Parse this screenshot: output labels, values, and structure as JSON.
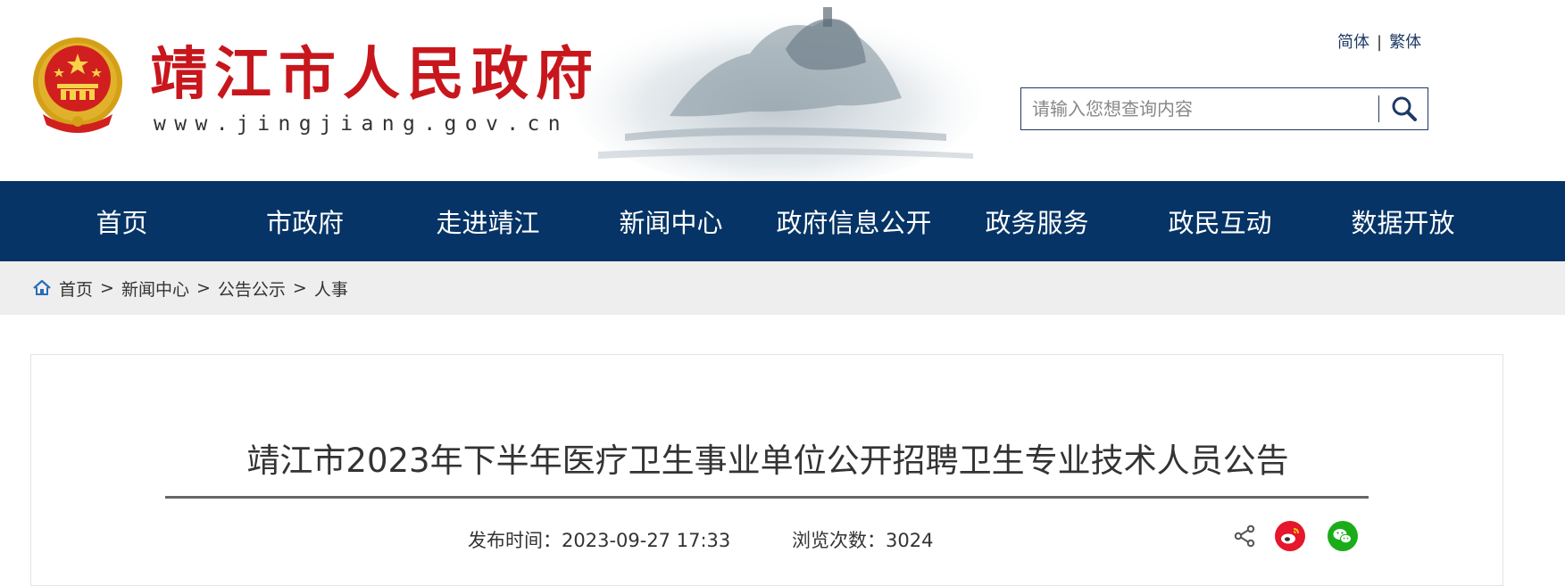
{
  "header": {
    "site_title": "靖江市人民政府",
    "site_url": "www.jingjiang.gov.cn",
    "lang_simplified": "简体",
    "lang_separator": "|",
    "lang_traditional": "繁体",
    "search": {
      "placeholder": "请输入您想查询内容"
    }
  },
  "nav": {
    "items": [
      {
        "label": "首页"
      },
      {
        "label": "市政府"
      },
      {
        "label": "走进靖江"
      },
      {
        "label": "新闻中心"
      },
      {
        "label": "政府信息公开"
      },
      {
        "label": "政务服务"
      },
      {
        "label": "政民互动"
      },
      {
        "label": "数据开放"
      }
    ]
  },
  "breadcrumb": {
    "items": [
      {
        "label": "首页"
      },
      {
        "label": "新闻中心"
      },
      {
        "label": "公告公示"
      },
      {
        "label": "人事"
      }
    ],
    "separator": ">"
  },
  "article": {
    "title": "靖江市2023年下半年医疗卫生事业单位公开招聘卫生专业技术人员公告",
    "publish_label": "发布时间：",
    "publish_time": "2023-09-27 17:33",
    "views_label": "浏览次数：",
    "views": "3024"
  },
  "colors": {
    "nav_background": "#063466",
    "title_red": "#c8161d",
    "breadcrumb_background": "#eeeeee",
    "weibo_red": "#e6162d",
    "wechat_green": "#1aad19"
  },
  "icons": [
    "national-emblem-icon",
    "landscape-image",
    "search-icon",
    "home-icon",
    "share-icon",
    "weibo-icon",
    "wechat-icon"
  ]
}
